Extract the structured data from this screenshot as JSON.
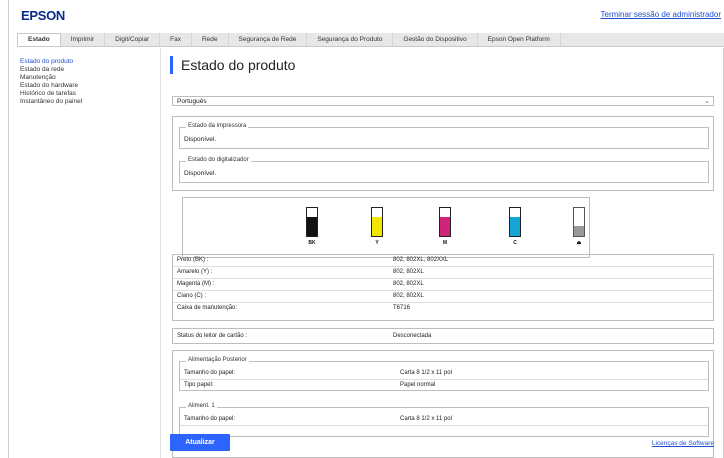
{
  "header": {
    "logo": "EPSON",
    "logout_link": "Terminar sessão de administrador"
  },
  "tabs": [
    {
      "label": "Estado"
    },
    {
      "label": "Imprimir"
    },
    {
      "label": "Digit/Copiar"
    },
    {
      "label": "Fax"
    },
    {
      "label": "Rede"
    },
    {
      "label": "Segurança de Rede"
    },
    {
      "label": "Segurança do Produto"
    },
    {
      "label": "Gestão do Dispositivo"
    },
    {
      "label": "Epson Open Platform"
    }
  ],
  "sidebar": {
    "items": [
      {
        "label": "Estado do produto"
      },
      {
        "label": "Estado da rede"
      },
      {
        "label": "Manutenção"
      },
      {
        "label": "Estado do hardware"
      },
      {
        "label": "Histórico de tarefas"
      },
      {
        "label": "Instantâneo do painel"
      }
    ]
  },
  "main": {
    "title": "Estado do produto",
    "language": "Português",
    "printer_status": {
      "legend": "Estado da impressora",
      "value": "Disponível."
    },
    "scanner_status": {
      "legend": "Estado do digitalizador",
      "value": "Disponível."
    }
  },
  "inks": [
    {
      "label": "BK",
      "color": "#111111",
      "level": 0.68
    },
    {
      "label": "Y",
      "color": "#f2e500",
      "level": 0.68
    },
    {
      "label": "M",
      "color": "#d0237a",
      "level": 0.68
    },
    {
      "label": "C",
      "color": "#15a6d8",
      "level": 0.68
    },
    {
      "label": "",
      "color": "#9a9a9a",
      "level": 0.35,
      "icon": "maintenance-box-icon"
    }
  ],
  "ink_table": [
    {
      "label": "Preto (BK) :",
      "value": "802, 802XL, 802XXL"
    },
    {
      "label": "Amarelo (Y) :",
      "value": "802, 802XL"
    },
    {
      "label": "Magenta (M) :",
      "value": "802, 802XL"
    },
    {
      "label": "Ciano (C) :",
      "value": "802, 802XL"
    },
    {
      "label": "Caixa de manutenção:",
      "value": "T6716"
    }
  ],
  "card_reader": {
    "label": "Status do leitor de cartão :",
    "value": "Desconectada"
  },
  "paper": {
    "rear_feed": {
      "legend": "Alimentação Posterior",
      "size_label": "Tamanho do papel:",
      "size_value": "Carta 8 1/2 x 11 pol",
      "type_label": "Tipo papel:",
      "type_value": "Papel normal"
    },
    "cassette1": {
      "legend": "Aliment. 1",
      "size_label": "Tamanho do papel:",
      "size_value": "Carta 8 1/2 x 11 pol"
    }
  },
  "footer": {
    "update_button": "Atualizar",
    "license_link": "Licenças de Software"
  }
}
